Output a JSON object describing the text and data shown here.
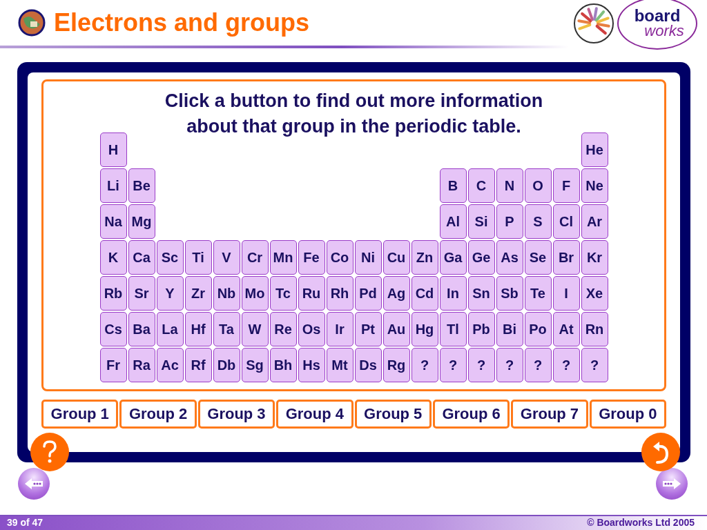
{
  "header": {
    "title": "Electrons and groups",
    "logo": [
      "board",
      "works"
    ]
  },
  "panel": {
    "instruction": "Click a button to find out more information\nabout that group in the periodic table.",
    "rows": [
      {
        "left": [
          "H"
        ],
        "right": [
          "He"
        ]
      },
      {
        "left": [
          "Li",
          "Be"
        ],
        "right": [
          "B",
          "C",
          "N",
          "O",
          "F",
          "Ne"
        ]
      },
      {
        "left": [
          "Na",
          "Mg"
        ],
        "right": [
          "Al",
          "Si",
          "P",
          "S",
          "Cl",
          "Ar"
        ]
      },
      {
        "left": [
          "K",
          "Ca",
          "Sc",
          "Ti",
          "V",
          "Cr",
          "Mn",
          "Fe",
          "Co",
          "Ni",
          "Cu",
          "Zn",
          "Ga",
          "Ge",
          "As",
          "Se",
          "Br",
          "Kr"
        ],
        "right": []
      },
      {
        "left": [
          "Rb",
          "Sr",
          "Y",
          "Zr",
          "Nb",
          "Mo",
          "Tc",
          "Ru",
          "Rh",
          "Pd",
          "Ag",
          "Cd",
          "In",
          "Sn",
          "Sb",
          "Te",
          "I",
          "Xe"
        ],
        "right": []
      },
      {
        "left": [
          "Cs",
          "Ba",
          "La",
          "Hf",
          "Ta",
          "W",
          "Re",
          "Os",
          "Ir",
          "Pt",
          "Au",
          "Hg",
          "Tl",
          "Pb",
          "Bi",
          "Po",
          "At",
          "Rn"
        ],
        "right": []
      },
      {
        "left": [
          "Fr",
          "Ra",
          "Ac",
          "Rf",
          "Db",
          "Sg",
          "Bh",
          "Hs",
          "Mt",
          "Ds",
          "Rg",
          "?",
          "?",
          "?",
          "?",
          "?",
          "?",
          "?"
        ],
        "right": []
      }
    ],
    "group_buttons": [
      "Group 1",
      "Group 2",
      "Group 3",
      "Group 4",
      "Group 5",
      "Group 6",
      "Group 7",
      "Group 0"
    ]
  },
  "footer": {
    "slide_counter": "39 of 47",
    "copyright": "© Boardworks Ltd 2005"
  }
}
